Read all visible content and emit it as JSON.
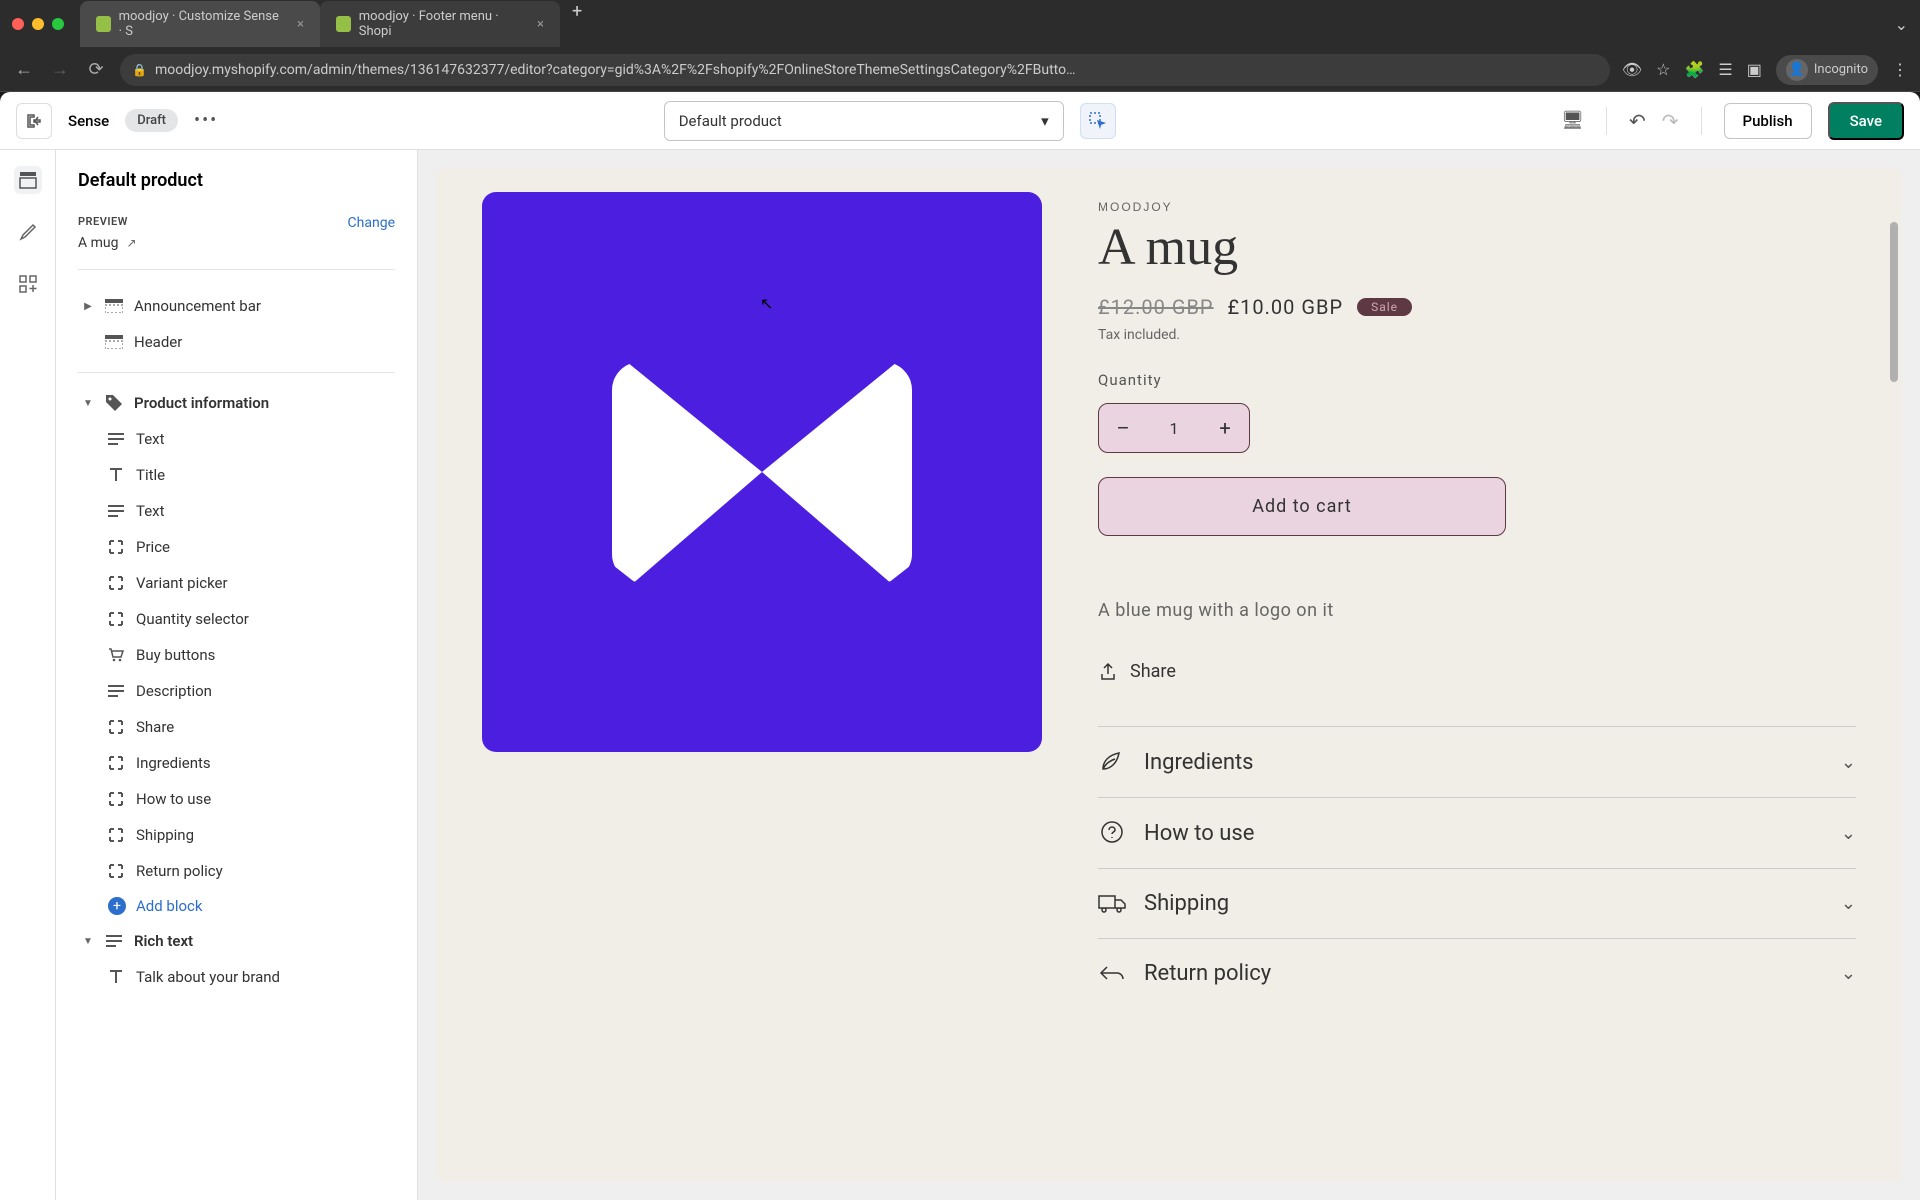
{
  "browser": {
    "tabs": [
      {
        "title": "moodjoy · Customize Sense · S"
      },
      {
        "title": "moodjoy · Footer menu · Shopi"
      }
    ],
    "url": "moodjoy.myshopify.com/admin/themes/136147632377/editor?category=gid%3A%2F%2Fshopify%2FOnlineStoreThemeSettingsCategory%2FButto…",
    "incognito_label": "Incognito"
  },
  "topbar": {
    "theme": "Sense",
    "status": "Draft",
    "template_select": "Default product",
    "publish": "Publish",
    "save": "Save"
  },
  "sidebar": {
    "title": "Default product",
    "preview_label": "PREVIEW",
    "preview_name": "A mug",
    "change": "Change",
    "sections": [
      {
        "label": "Announcement bar",
        "collapsible": true,
        "open": false
      },
      {
        "label": "Header",
        "collapsible": false
      }
    ],
    "product_info": {
      "label": "Product information",
      "blocks": [
        "Text",
        "Title",
        "Text",
        "Price",
        "Variant picker",
        "Quantity selector",
        "Buy buttons",
        "Description",
        "Share",
        "Ingredients",
        "How to use",
        "Shipping",
        "Return policy"
      ],
      "add_block": "Add block"
    },
    "rich_text": {
      "label": "Rich text",
      "blocks": [
        "Talk about your brand"
      ]
    }
  },
  "product": {
    "vendor": "MOODJOY",
    "title": "A mug",
    "old_price": "£12.00 GBP",
    "price": "£10.00 GBP",
    "sale_badge": "Sale",
    "tax": "Tax included.",
    "qty_label": "Quantity",
    "qty_value": "1",
    "add_to_cart": "Add to cart",
    "description": "A blue mug with a logo on it",
    "share": "Share",
    "accordion": [
      "Ingredients",
      "How to use",
      "Shipping",
      "Return policy"
    ]
  }
}
